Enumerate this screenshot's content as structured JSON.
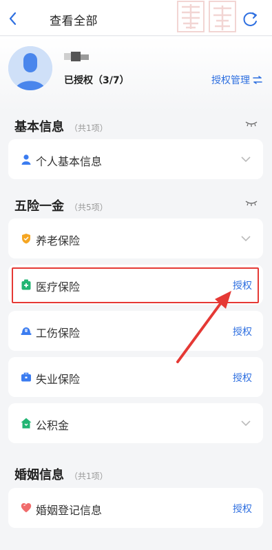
{
  "header": {
    "title": "查看全部",
    "back_icon": "chevron-left-icon",
    "refresh_icon": "refresh-icon"
  },
  "profile": {
    "auth_status": "已授权（3/7）",
    "manage_label": "授权管理",
    "manage_icon": "swap-icon"
  },
  "sections": {
    "basic": {
      "title": "基本信息",
      "count": "（共1项）"
    },
    "insurance": {
      "title": "五险一金",
      "count": "（共5项）"
    },
    "marriage": {
      "title": "婚姻信息",
      "count": "（共1项）"
    }
  },
  "items": {
    "personal": {
      "label": "个人基本信息",
      "icon": "person-icon"
    },
    "pension": {
      "label": "养老保险",
      "icon": "shield-icon"
    },
    "medical": {
      "label": "医疗保险",
      "icon": "medical-kit-icon",
      "action": "授权"
    },
    "injury": {
      "label": "工伤保险",
      "icon": "helmet-icon",
      "action": "授权"
    },
    "unemployment": {
      "label": "失业保险",
      "icon": "briefcase-icon",
      "action": "授权"
    },
    "fund": {
      "label": "公积金",
      "icon": "house-icon"
    },
    "marriage_reg": {
      "label": "婚姻登记信息",
      "icon": "heart-icon",
      "action": "授权"
    }
  },
  "colors": {
    "accent": "#2e6fe0",
    "highlight": "#e53935",
    "background": "#f4f5f7"
  }
}
